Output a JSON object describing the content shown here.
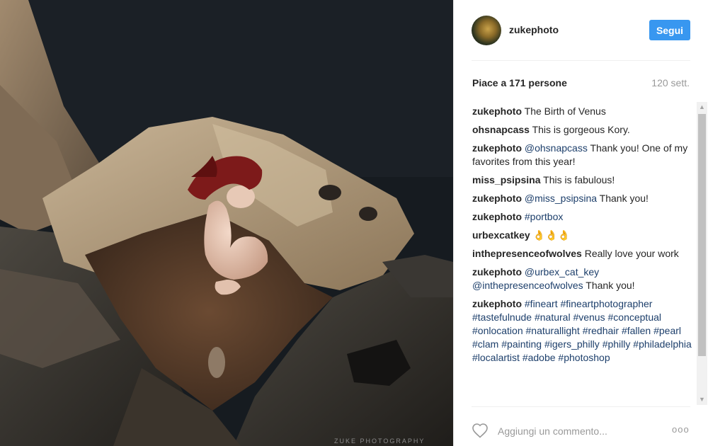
{
  "post": {
    "username": "zukephoto",
    "follow_label": "Segui",
    "likes_text": "Piace a 171 persone",
    "time_ago": "120 sett.",
    "watermark": "ZUKE PHOTOGRAPHY"
  },
  "comments": [
    {
      "user": "zukephoto",
      "text": " The Birth of Venus"
    },
    {
      "user": "ohsnapcass",
      "text": " This is gorgeous Kory."
    },
    {
      "user": "zukephoto",
      "mention": "@ohsnapcass",
      "text": " Thank you! One of my favorites from this year!"
    },
    {
      "user": "miss_psipsina",
      "text": " This is fabulous!"
    },
    {
      "user": "zukephoto",
      "mention": "@miss_psipsina",
      "text": " Thank you!"
    },
    {
      "user": "zukephoto",
      "tag": "#portbox"
    },
    {
      "user": "urbexcatkey",
      "text": " 👌👌👌"
    },
    {
      "user": "inthepresenceofwolves",
      "text": " Really love your work"
    },
    {
      "user": "zukephoto",
      "mention": "@urbex_cat_key",
      "mention2": "@inthepresenceofwolves",
      "text": " Thank you!"
    },
    {
      "user": "zukephoto",
      "tags": [
        "#fineart",
        "#fineartphotographer",
        "#tastefulnude",
        "#natural",
        "#venus",
        "#conceptual",
        "#onlocation",
        "#naturallight",
        "#redhair",
        "#fallen",
        "#pearl",
        "#clam",
        "#painting",
        "#igers_philly",
        "#philly",
        "#philadelphia",
        "#localartist",
        "#adobe",
        "#photoshop"
      ]
    }
  ],
  "footer": {
    "comment_placeholder": "Aggiungi un commento...",
    "more_label": "ooo"
  },
  "icons": {
    "heart": "heart-icon",
    "more": "more-options-icon"
  },
  "colors": {
    "accent": "#3897f0",
    "hashtag": "#1d3f6b",
    "muted": "#999999"
  }
}
